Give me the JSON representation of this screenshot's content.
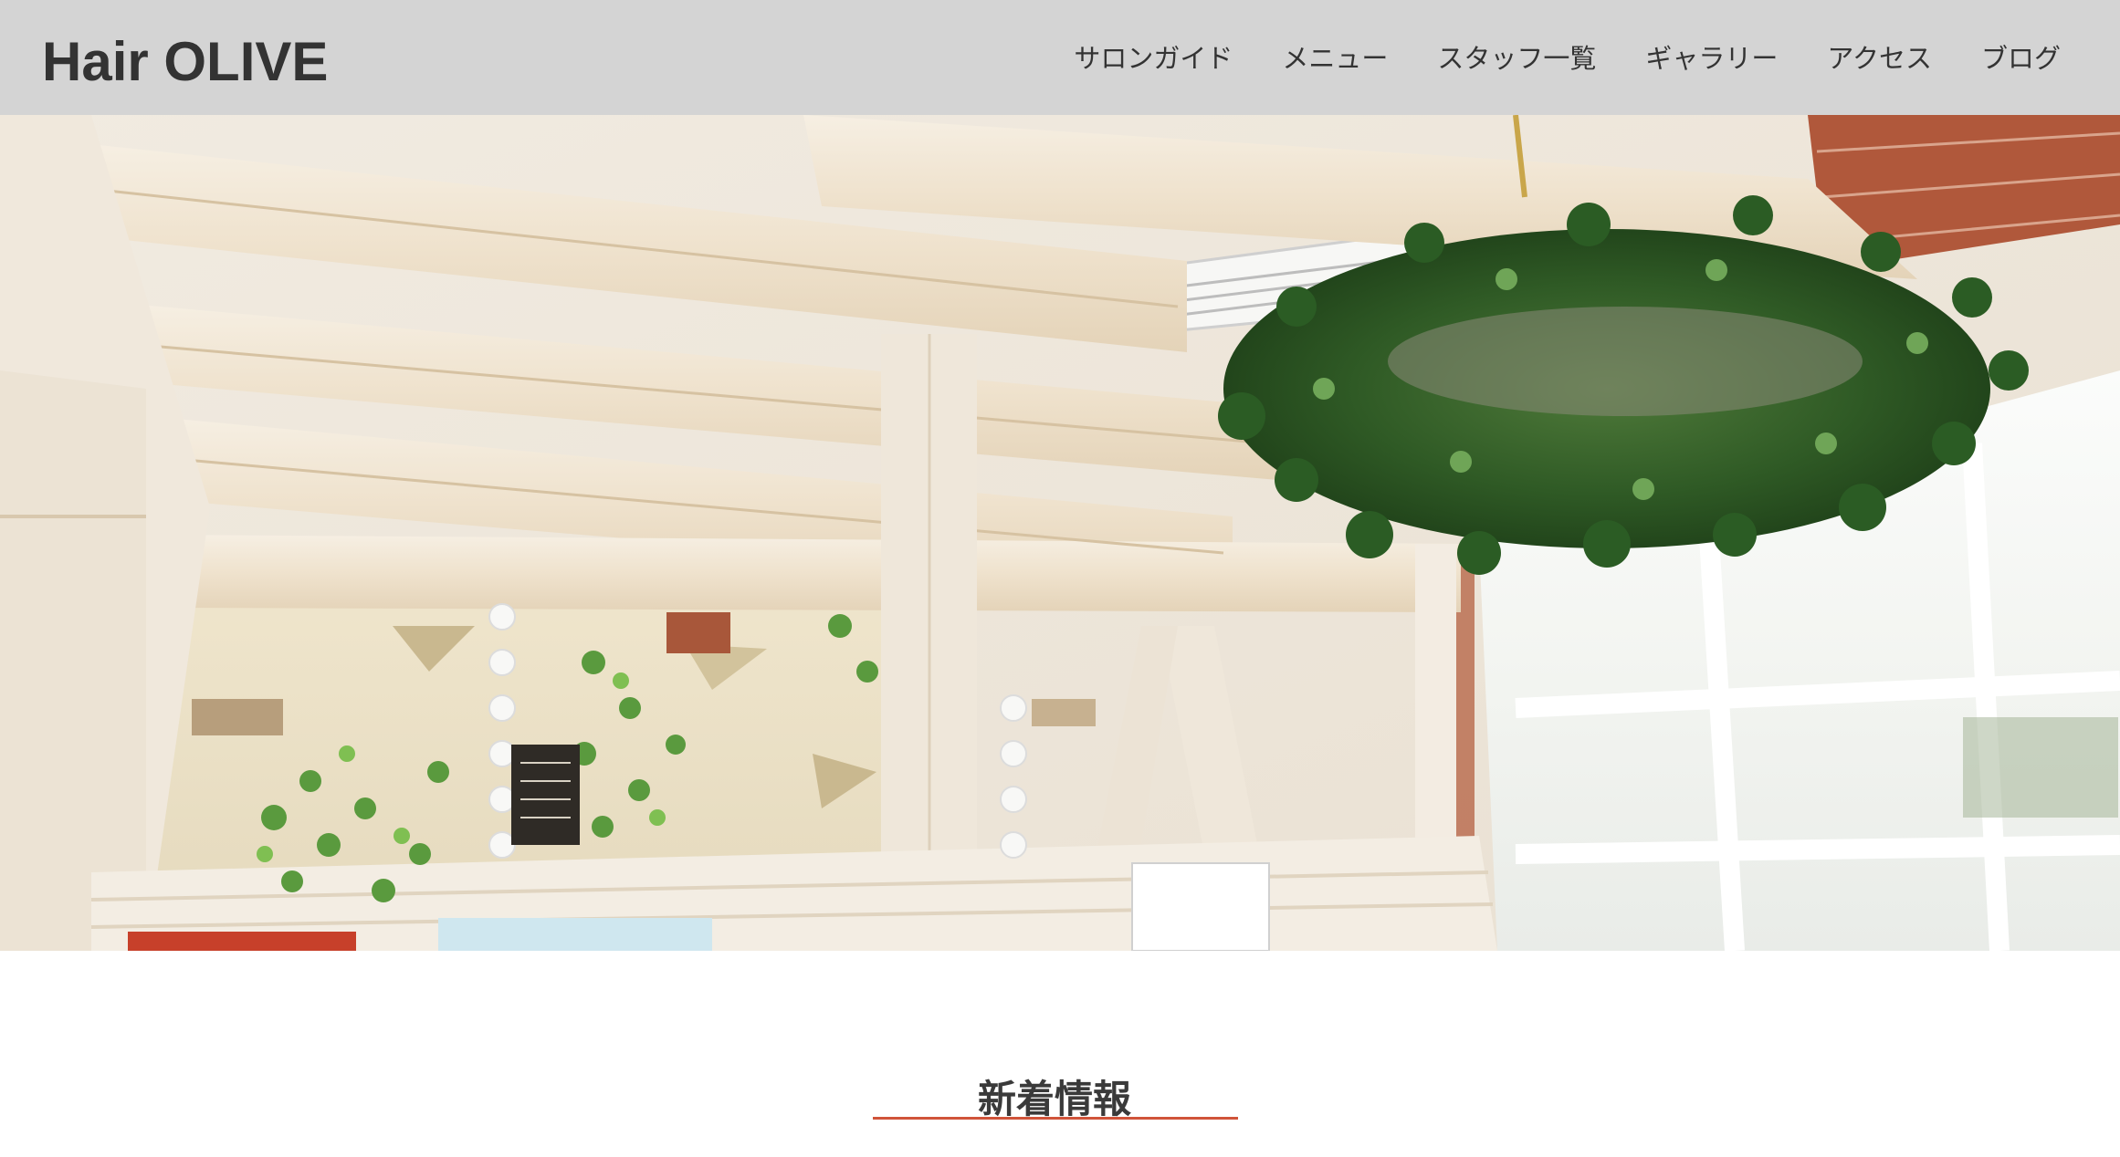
{
  "header": {
    "logo": "Hair OLIVE",
    "nav": [
      {
        "label": "サロンガイド"
      },
      {
        "label": "メニュー"
      },
      {
        "label": "スタッフ一覧"
      },
      {
        "label": "ギャラリー"
      },
      {
        "label": "アクセス"
      },
      {
        "label": "ブログ"
      }
    ]
  },
  "hero": {
    "image": "salon-interior-photo"
  },
  "news": {
    "title": "新着情報",
    "accent_color": "#d0543a"
  },
  "colors": {
    "header_bg": "#d4d4d4",
    "text": "#333333"
  }
}
